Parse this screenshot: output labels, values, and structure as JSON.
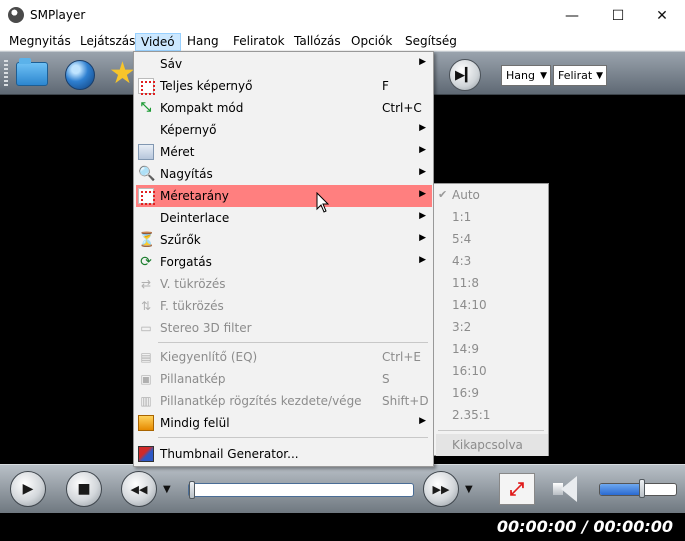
{
  "window": {
    "title": "SMPlayer",
    "minimize_glyph": "—",
    "maximize_glyph": "☐",
    "close_glyph": "✕"
  },
  "menubar": {
    "items": [
      "Megnyitás",
      "Lejátszás",
      "Videó",
      "Hang",
      "Feliratok",
      "Tallózás",
      "Opciók",
      "Segítség"
    ],
    "active_index": 2
  },
  "toolbar": {
    "audio_select": "Hang",
    "subtitle_select": "Felirat",
    "dropdown_glyph": "▼",
    "next_glyph": "▶▎"
  },
  "video_menu": {
    "items": [
      {
        "label": "Sáv",
        "shortcut": "",
        "submenu": true,
        "disabled": false,
        "icon": "none"
      },
      {
        "label": "Teljes képernyő",
        "shortcut": "F",
        "submenu": false,
        "disabled": false,
        "icon": "fullscreen-icon"
      },
      {
        "label": "Kompakt mód",
        "shortcut": "Ctrl+C",
        "submenu": false,
        "disabled": false,
        "icon": "compact-icon"
      },
      {
        "label": "Képernyő",
        "shortcut": "",
        "submenu": true,
        "disabled": false,
        "icon": "none"
      },
      {
        "label": "Méret",
        "shortcut": "",
        "submenu": true,
        "disabled": false,
        "icon": "size-icon"
      },
      {
        "label": "Nagyítás",
        "shortcut": "",
        "submenu": true,
        "disabled": false,
        "icon": "zoom-icon"
      },
      {
        "label": "Méretarány",
        "shortcut": "",
        "submenu": true,
        "disabled": false,
        "icon": "aspect-ratio-icon"
      },
      {
        "label": "Deinterlace",
        "shortcut": "",
        "submenu": true,
        "disabled": false,
        "icon": "none"
      },
      {
        "label": "Szűrők",
        "shortcut": "",
        "submenu": true,
        "disabled": false,
        "icon": "filter-icon"
      },
      {
        "label": "Forgatás",
        "shortcut": "",
        "submenu": true,
        "disabled": false,
        "icon": "rotate-icon"
      },
      {
        "label": "V. tükrözés",
        "shortcut": "",
        "submenu": false,
        "disabled": true,
        "icon": "flip-icon"
      },
      {
        "label": "F. tükrözés",
        "shortcut": "",
        "submenu": false,
        "disabled": true,
        "icon": "mirror-icon"
      },
      {
        "label": "Stereo 3D filter",
        "shortcut": "",
        "submenu": false,
        "disabled": true,
        "icon": "stereo3d-icon"
      },
      {
        "label": "Kiegyenlítő (EQ)",
        "shortcut": "Ctrl+E",
        "submenu": false,
        "disabled": true,
        "icon": "equalizer-icon"
      },
      {
        "label": "Pillanatkép",
        "shortcut": "S",
        "submenu": false,
        "disabled": true,
        "icon": "screenshot-icon"
      },
      {
        "label": "Pillanatkép rögzítés kezdete/vége",
        "shortcut": "Shift+D",
        "submenu": false,
        "disabled": true,
        "icon": "screenshots-icon"
      },
      {
        "label": "Mindig felül",
        "shortcut": "",
        "submenu": true,
        "disabled": false,
        "icon": "ontop-icon"
      },
      {
        "label": "Thumbnail Generator...",
        "shortcut": "",
        "submenu": false,
        "disabled": false,
        "icon": "thumbnail-icon"
      }
    ],
    "highlighted_index": 6,
    "submenu_glyph": "▶"
  },
  "aspect_submenu": {
    "items": [
      "Auto",
      "1:1",
      "5:4",
      "4:3",
      "11:8",
      "14:10",
      "3:2",
      "14:9",
      "16:10",
      "16:9",
      "2.35:1",
      "Kikapcsolva"
    ],
    "checked_index": 0,
    "check_glyph": "✔"
  },
  "controls": {
    "play_glyph": "▶",
    "stop_glyph": "■",
    "rewind_glyph": "◀◀",
    "forward_glyph": "▶▶",
    "fullscreen_glyph": "⤢",
    "seek_fraction": 0.0,
    "volume_fraction": 0.55
  },
  "status": {
    "time": "00:00:00 / 00:00:00"
  }
}
